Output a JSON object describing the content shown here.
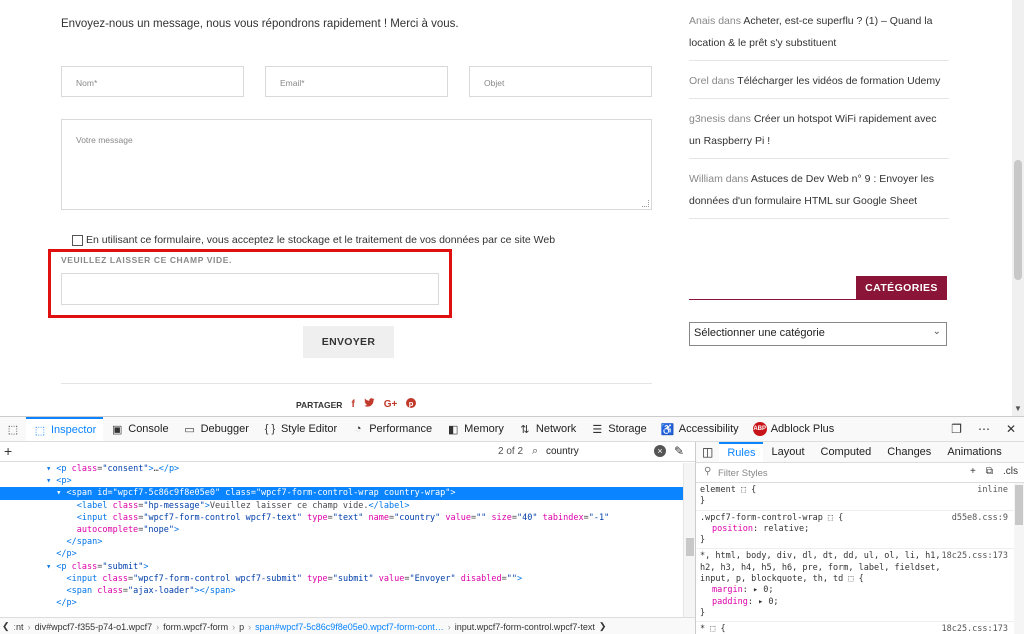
{
  "site": {
    "intro": "Envoyez-nous un message, nous vous répondrons rapidement ! Merci à vous.",
    "fields": {
      "nom": "Nom*",
      "email": "Email*",
      "objet": "Objet",
      "message": "Votre message"
    },
    "consent": "En utilisant ce formulaire, vous acceptez le stockage et le traitement de vos données par ce site Web",
    "honeypot_label": "VEUILLEZ LAISSER CE CHAMP VIDE.",
    "send_button": "ENVOYER",
    "share_label": "PARTAGER",
    "share_icons": [
      "f",
      "♥",
      "G+",
      "℗"
    ],
    "comments": [
      {
        "author": "Anais",
        "in": "dans",
        "title": "Acheter, est-ce superflu ? (1) – Quand la location & le prêt s'y substituent"
      },
      {
        "author": "Orel",
        "in": "dans",
        "title": "Télécharger les vidéos de formation Udemy"
      },
      {
        "author": "g3nesis",
        "in": "dans",
        "title": "Créer un hotspot WiFi rapidement avec un Raspberry Pi !"
      },
      {
        "author": "William",
        "in": "dans",
        "title": "Astuces de Dev Web n° 9 : Envoyer les données d'un formulaire HTML sur Google Sheet"
      }
    ],
    "categories_title": "CATÉGORIES",
    "category_select": "Sélectionner une catégorie",
    "highlight_color": "#e01010",
    "accent_color": "#8a1538"
  },
  "devtools": {
    "tabs": [
      {
        "label": "Inspector",
        "icon": "inspector-icon",
        "glyph": "⬚"
      },
      {
        "label": "Console",
        "icon": "console-icon",
        "glyph": "▣"
      },
      {
        "label": "Debugger",
        "icon": "debugger-icon",
        "glyph": "▭"
      },
      {
        "label": "Style Editor",
        "icon": "braces-icon",
        "glyph": "{ }"
      },
      {
        "label": "Performance",
        "icon": "performance-icon",
        "glyph": "◔"
      },
      {
        "label": "Memory",
        "icon": "memory-icon",
        "glyph": "◧"
      },
      {
        "label": "Network",
        "icon": "network-icon",
        "glyph": "⇅"
      },
      {
        "label": "Storage",
        "icon": "storage-icon",
        "glyph": "☰"
      },
      {
        "label": "Accessibility",
        "icon": "accessibility-icon",
        "glyph": "♿"
      },
      {
        "label": "Adblock Plus",
        "icon": "abp-icon",
        "glyph": "ABP"
      }
    ],
    "search": {
      "count": "2 of 2",
      "query": "country"
    },
    "markup_lines": [
      {
        "indent": 9,
        "html": "<span class=\"tag\">▾ &lt;p</span> <span class=\"an\">class</span>=<span class=\"av\">\"consent\"</span><span class=\"tag\">&gt;</span>…<span class=\"tag\">&lt;/p&gt;</span>"
      },
      {
        "indent": 9,
        "html": "<span class=\"tag\">▾ &lt;p&gt;</span>"
      },
      {
        "indent": 11,
        "sel": true,
        "html": "<span class=\"tag\">▾ &lt;span</span> <span class=\"an\">id</span>=<span class=\"av\">\"wpcf7-5c86c9f8e05e0\"</span> <span class=\"an\">class</span>=<span class=\"av\">\"wpcf7-form-control-wrap country-wrap\"</span><span class=\"tag\">&gt;</span>"
      },
      {
        "indent": 15,
        "html": "<span class=\"tag\">&lt;label</span> <span class=\"an\">class</span>=<span class=\"av\">\"hp-message\"</span><span class=\"tag\">&gt;</span>Veuillez laisser ce champ vide.<span class=\"tag\">&lt;/label&gt;</span>"
      },
      {
        "indent": 15,
        "html": "<span class=\"tag\">&lt;input</span> <span class=\"an\">class</span>=<span class=\"av\">\"wpcf7-form-control wpcf7-text\"</span> <span class=\"an\">type</span>=<span class=\"av\">\"text\"</span> <span class=\"an\">name</span>=<span class=\"av\">\"country\"</span> <span class=\"an\">value</span>=<span class=\"av\">\"\"</span> <span class=\"an\">size</span>=<span class=\"av\">\"40\"</span> <span class=\"an\">tabindex</span>=<span class=\"av\">\"-1\"</span>"
      },
      {
        "indent": 15,
        "html": "<span class=\"an\">autocomplete</span>=<span class=\"av\">\"nope\"</span><span class=\"tag\">&gt;</span>"
      },
      {
        "indent": 13,
        "html": "<span class=\"tag\">&lt;/span&gt;</span>"
      },
      {
        "indent": 11,
        "html": "<span class=\"tag\">&lt;/p&gt;</span>"
      },
      {
        "indent": 9,
        "html": "<span class=\"tag\">▾ &lt;p</span> <span class=\"an\">class</span>=<span class=\"av\">\"submit\"</span><span class=\"tag\">&gt;</span>"
      },
      {
        "indent": 13,
        "html": "<span class=\"tag\">&lt;input</span> <span class=\"an\">class</span>=<span class=\"av\">\"wpcf7-form-control wpcf7-submit\"</span> <span class=\"an\">type</span>=<span class=\"av\">\"submit\"</span> <span class=\"an\">value</span>=<span class=\"av\">\"Envoyer\"</span> <span class=\"an\">disabled</span>=<span class=\"av\">\"\"</span><span class=\"tag\">&gt;</span>"
      },
      {
        "indent": 13,
        "html": "<span class=\"tag\">&lt;span</span> <span class=\"an\">class</span>=<span class=\"av\">\"ajax-loader\"</span><span class=\"tag\">&gt;&lt;/span&gt;</span>"
      },
      {
        "indent": 11,
        "html": "<span class=\"tag\">&lt;/p&gt;</span>"
      }
    ],
    "breadcrumbs": [
      "ːnt",
      "div#wpcf7-f355-p74-o1.wpcf7",
      "form.wpcf7-form",
      "p",
      "span#wpcf7-5c86c9f8e05e0.wpcf7-form-cont…",
      "input.wpcf7-form-control.wpcf7-text"
    ],
    "rules_tabs": [
      "Rules",
      "Layout",
      "Computed",
      "Changes",
      "Animations"
    ],
    "filter_placeholder": "Filter Styles",
    "cls_label": ".cls",
    "rules": [
      {
        "selector": "element ⬚ {",
        "source": "inline",
        "props": [],
        "close": "}"
      },
      {
        "selector": ".wpcf7-form-control-wrap ⬚ {",
        "source": "d55e8.css:9",
        "props": [
          [
            "position",
            "relative;"
          ]
        ],
        "close": "}"
      },
      {
        "selector": "*, html, body, div, dl, dt, dd, ul, ol, li, h1, h2, h3, h4, h5, h6, pre, form, label, fieldset, input, p, blockquote, th, td ⬚ {",
        "source": "18c25.css:173",
        "props": [
          [
            "margin",
            "▸ 0;"
          ],
          [
            "padding",
            "▸ 0;"
          ]
        ],
        "close": "}"
      },
      {
        "selector": "* ⬚ {",
        "source": "18c25.css:173",
        "props": [],
        "close": ""
      }
    ]
  }
}
